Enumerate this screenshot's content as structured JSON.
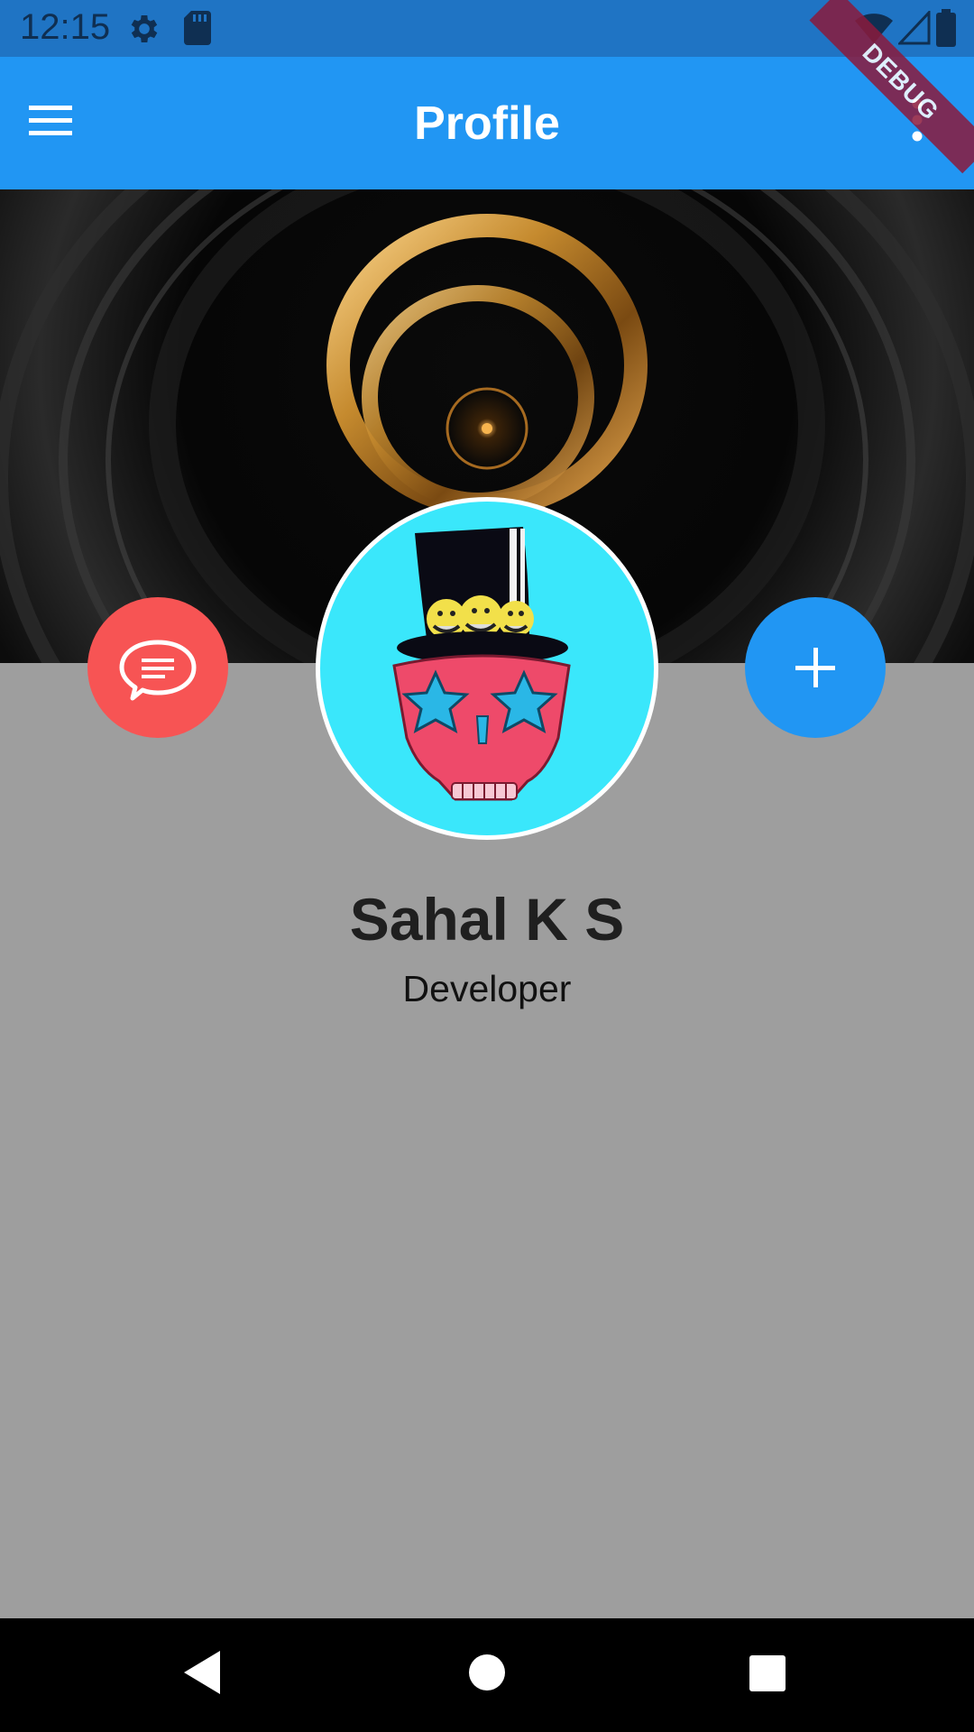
{
  "status_bar": {
    "time": "12:15",
    "icons": [
      "settings-icon",
      "sd-card-icon",
      "wifi-icon",
      "signal-icon",
      "battery-icon"
    ]
  },
  "app_bar": {
    "title": "Profile",
    "menu_icon": "hamburger-menu-icon",
    "more_icon": "more-vert-icon",
    "background": "#2196f3"
  },
  "debug_banner": {
    "label": "DEBUG"
  },
  "profile": {
    "name": "Sahal K S",
    "role": "Developer"
  },
  "actions": {
    "chat_icon": "chat-bubble-icon",
    "chat_color": "#f75454",
    "add_icon": "add-icon",
    "add_color": "#2196f3"
  },
  "nav_bar": {
    "icons": [
      "back-icon",
      "home-icon",
      "recents-icon"
    ]
  }
}
